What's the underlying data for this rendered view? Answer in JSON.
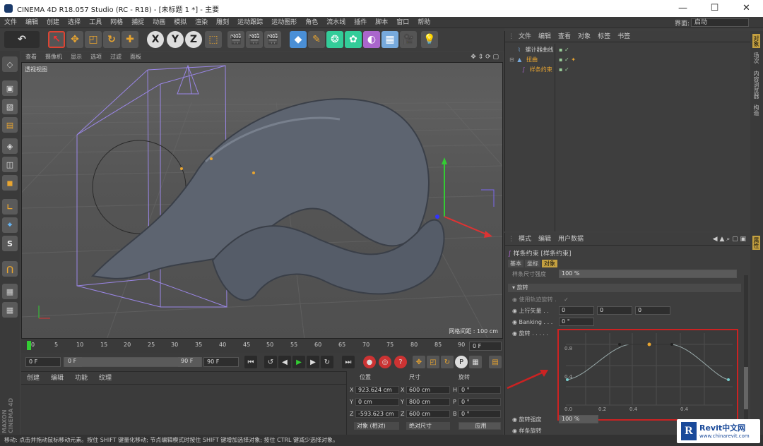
{
  "window": {
    "title": "CINEMA 4D R18.057 Studio (RC - R18) - [未标题 1 *] - 主要",
    "minimize": "—",
    "maximize": "☐",
    "close": "✕"
  },
  "menubar": {
    "items": [
      "文件",
      "编辑",
      "创建",
      "选择",
      "工具",
      "网格",
      "捕捉",
      "动画",
      "模拟",
      "渲染",
      "雕刻",
      "运动跟踪",
      "运动图形",
      "角色",
      "流水线",
      "插件",
      "脚本",
      "窗口",
      "帮助"
    ],
    "interface_label": "界面:",
    "interface_value": "启动"
  },
  "viewport": {
    "menu": [
      "查看",
      "摄像机",
      "显示",
      "选项",
      "过滤",
      "面板"
    ],
    "label": "透视视图",
    "grid_label": "网格间距 : 100 cm"
  },
  "timeline": {
    "ticks": [
      "0",
      "5",
      "10",
      "15",
      "20",
      "25",
      "30",
      "35",
      "40",
      "45",
      "50",
      "55",
      "60",
      "65",
      "70",
      "75",
      "80",
      "85",
      "90"
    ],
    "frame_field": "0 F"
  },
  "playbar": {
    "start": "0 F",
    "current": "0 F",
    "slider_end": "90 F",
    "end": "90 F"
  },
  "material_panel": {
    "menu": [
      "创建",
      "编辑",
      "功能",
      "纹理"
    ]
  },
  "coords": {
    "headers": [
      "位置",
      "尺寸",
      "旋转"
    ],
    "rows": [
      {
        "a": "X",
        "pos": "923.624 cm",
        "b": "X",
        "size": "600 cm",
        "c": "H",
        "rot": "0 °"
      },
      {
        "a": "Y",
        "pos": "0 cm",
        "b": "Y",
        "size": "800 cm",
        "c": "P",
        "rot": "0 °"
      },
      {
        "a": "Z",
        "pos": "-593.623 cm",
        "b": "Z",
        "size": "600 cm",
        "c": "B",
        "rot": "0 °"
      }
    ],
    "mode1": "对象 (相对)",
    "mode2": "绝对尺寸",
    "apply": "应用"
  },
  "status": "移动: 点击并拖动鼠标移动元素。按住 SHIFT 键量化移动; 节点编辑模式时按住 SHIFT 键增加选择对象; 按住 CTRL 键减少选择对象。",
  "object_manager": {
    "menu": [
      "文件",
      "编辑",
      "查看",
      "对象",
      "标签",
      "书签"
    ],
    "items": [
      "螺计器曲线",
      "扭曲",
      "样条约束"
    ]
  },
  "attribute_manager": {
    "menu": [
      "模式",
      "编辑",
      "用户数据"
    ],
    "title": "样条约束 [样条约束]",
    "tabs": [
      "基本",
      "坐标",
      "对象"
    ],
    "scale_label": "样条尺寸强度",
    "scale_value": "100 %",
    "section": "旋转",
    "rows": [
      {
        "label": "使用轨迹旋转 .",
        "value": "✓"
      },
      {
        "label": "上行矢量 . .",
        "v1": "0",
        "v2": "0",
        "v3": "0"
      },
      {
        "label": "Banking . . .",
        "v1": "0 °"
      },
      {
        "label": "旋转 . . . . ."
      }
    ],
    "graph_y": [
      "0.8",
      "0.4"
    ],
    "graph_x": [
      "0.0",
      "0.2",
      "0.4",
      "0.4"
    ],
    "strength_label": "旋转强度",
    "strength_value": "100 %",
    "spline_rotate": "样条旋转"
  },
  "right_tabs": [
    "对象",
    "场次",
    "内容浏览器",
    "构造"
  ],
  "right_tabs2": [
    "属性"
  ],
  "maxon": "MAXON CINEMA 4D",
  "watermark": {
    "brand": "Revit中文网",
    "url": "www.chinarevit.com"
  },
  "colors": {
    "highlight": "#d9a94a",
    "accent_red": "#cc2222",
    "selection": "#c4a040"
  }
}
